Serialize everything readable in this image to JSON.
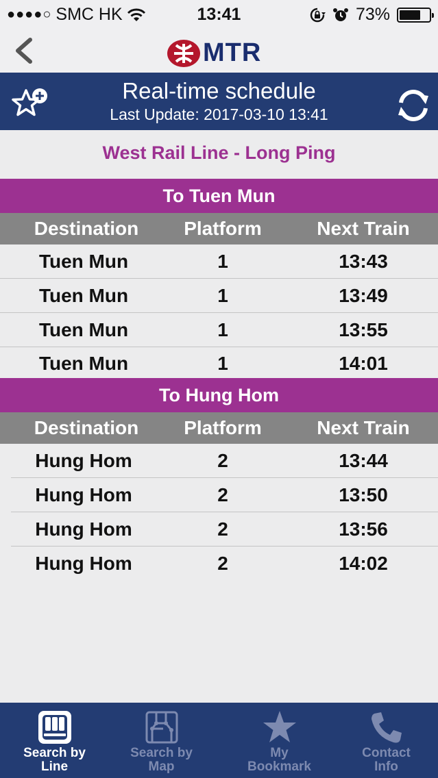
{
  "status_bar": {
    "signal": "●●●●○",
    "carrier": "SMC HK",
    "time": "13:41",
    "battery": "73%",
    "battery_level": 0.73
  },
  "app": {
    "logo_text": "MTR"
  },
  "header": {
    "title": "Real-time schedule",
    "last_update": "Last Update: 2017-03-10 13:41"
  },
  "line_title": "West Rail Line - Long Ping",
  "columns": {
    "destination": "Destination",
    "platform": "Platform",
    "next_train": "Next Train"
  },
  "sections": [
    {
      "title": "To Tuen Mun",
      "rows": [
        {
          "destination": "Tuen Mun",
          "platform": "1",
          "time": "13:43"
        },
        {
          "destination": "Tuen Mun",
          "platform": "1",
          "time": "13:49"
        },
        {
          "destination": "Tuen Mun",
          "platform": "1",
          "time": "13:55"
        },
        {
          "destination": "Tuen Mun",
          "platform": "1",
          "time": "14:01"
        }
      ]
    },
    {
      "title": "To Hung Hom",
      "rows": [
        {
          "destination": "Hung Hom",
          "platform": "2",
          "time": "13:44"
        },
        {
          "destination": "Hung Hom",
          "platform": "2",
          "time": "13:50"
        },
        {
          "destination": "Hung Hom",
          "platform": "2",
          "time": "13:56"
        },
        {
          "destination": "Hung Hom",
          "platform": "2",
          "time": "14:02"
        }
      ]
    }
  ],
  "tabs": [
    {
      "line1": "Search by",
      "line2": "Line",
      "icon": "train-icon",
      "active": true
    },
    {
      "line1": "Search by",
      "line2": "Map",
      "icon": "map-icon",
      "active": false
    },
    {
      "line1": "My",
      "line2": "Bookmark",
      "icon": "star-icon",
      "active": false
    },
    {
      "line1": "Contact",
      "line2": "Info",
      "icon": "phone-icon",
      "active": false
    }
  ],
  "colors": {
    "header_blue": "#233c73",
    "section_purple": "#9c3191",
    "column_gray": "#858585",
    "mtr_red": "#b4172c"
  }
}
